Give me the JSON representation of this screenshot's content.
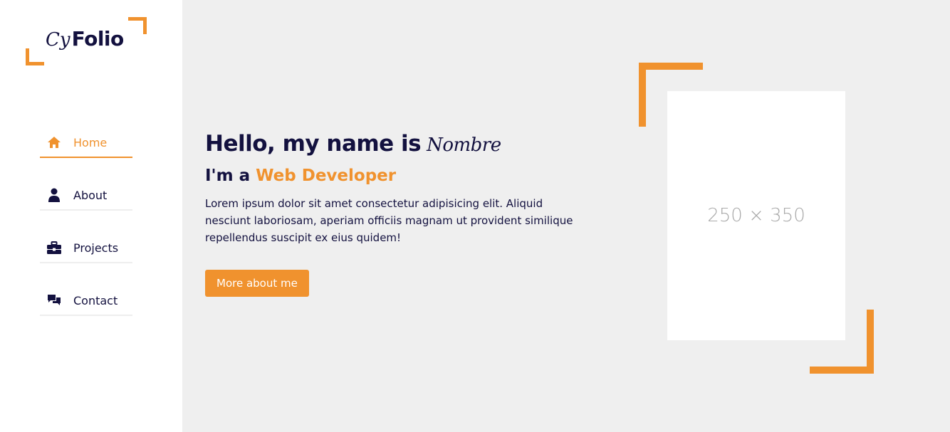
{
  "logo": {
    "script": "Cy",
    "bold": "Folio"
  },
  "nav": [
    {
      "label": "Home",
      "icon": "home-icon",
      "active": true
    },
    {
      "label": "About",
      "icon": "user-icon",
      "active": false
    },
    {
      "label": "Projects",
      "icon": "briefcase-icon",
      "active": false
    },
    {
      "label": "Contact",
      "icon": "chat-icon",
      "active": false
    }
  ],
  "hero": {
    "greeting": "Hello, my name is",
    "name": "Nombre",
    "role_prefix": "I'm a",
    "role": "Web Developer",
    "description": "Lorem ipsum dolor sit amet consectetur adipisicing elit. Aliquid nesciunt laboriosam, aperiam officiis magnam ut provident similique repellendus suscipit ex eius quidem!",
    "button_label": "More about me"
  },
  "image": {
    "placeholder_text": "250 × 350"
  },
  "colors": {
    "accent": "#f0922e",
    "text": "#13113f",
    "background": "#efefef"
  }
}
